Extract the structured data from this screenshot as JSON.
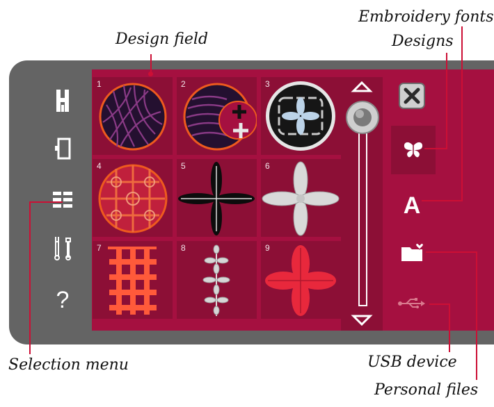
{
  "callouts": {
    "embroidery_fonts": "Embroidery fonts",
    "designs": "Designs",
    "design_field": "Design field",
    "selection_menu": "Selection menu",
    "usb_device": "USB device",
    "personal_files": "Personal files"
  },
  "sidebar": {
    "items": [
      {
        "icon": "presser-foot-icon"
      },
      {
        "icon": "embroidery-hoop-icon"
      },
      {
        "icon": "selection-menu-icon"
      },
      {
        "icon": "tools-icon"
      },
      {
        "icon": "help-icon",
        "label": "?"
      }
    ]
  },
  "designs": [
    {
      "number": "1"
    },
    {
      "number": "2"
    },
    {
      "number": "3"
    },
    {
      "number": "4"
    },
    {
      "number": "5"
    },
    {
      "number": "6"
    },
    {
      "number": "7"
    },
    {
      "number": "8"
    },
    {
      "number": "9"
    }
  ],
  "tabs": {
    "fonts_label": "A"
  },
  "colors": {
    "accent": "#cc0f35",
    "panel": "#a51040",
    "cell": "#8c0f36",
    "frame": "#646464"
  }
}
